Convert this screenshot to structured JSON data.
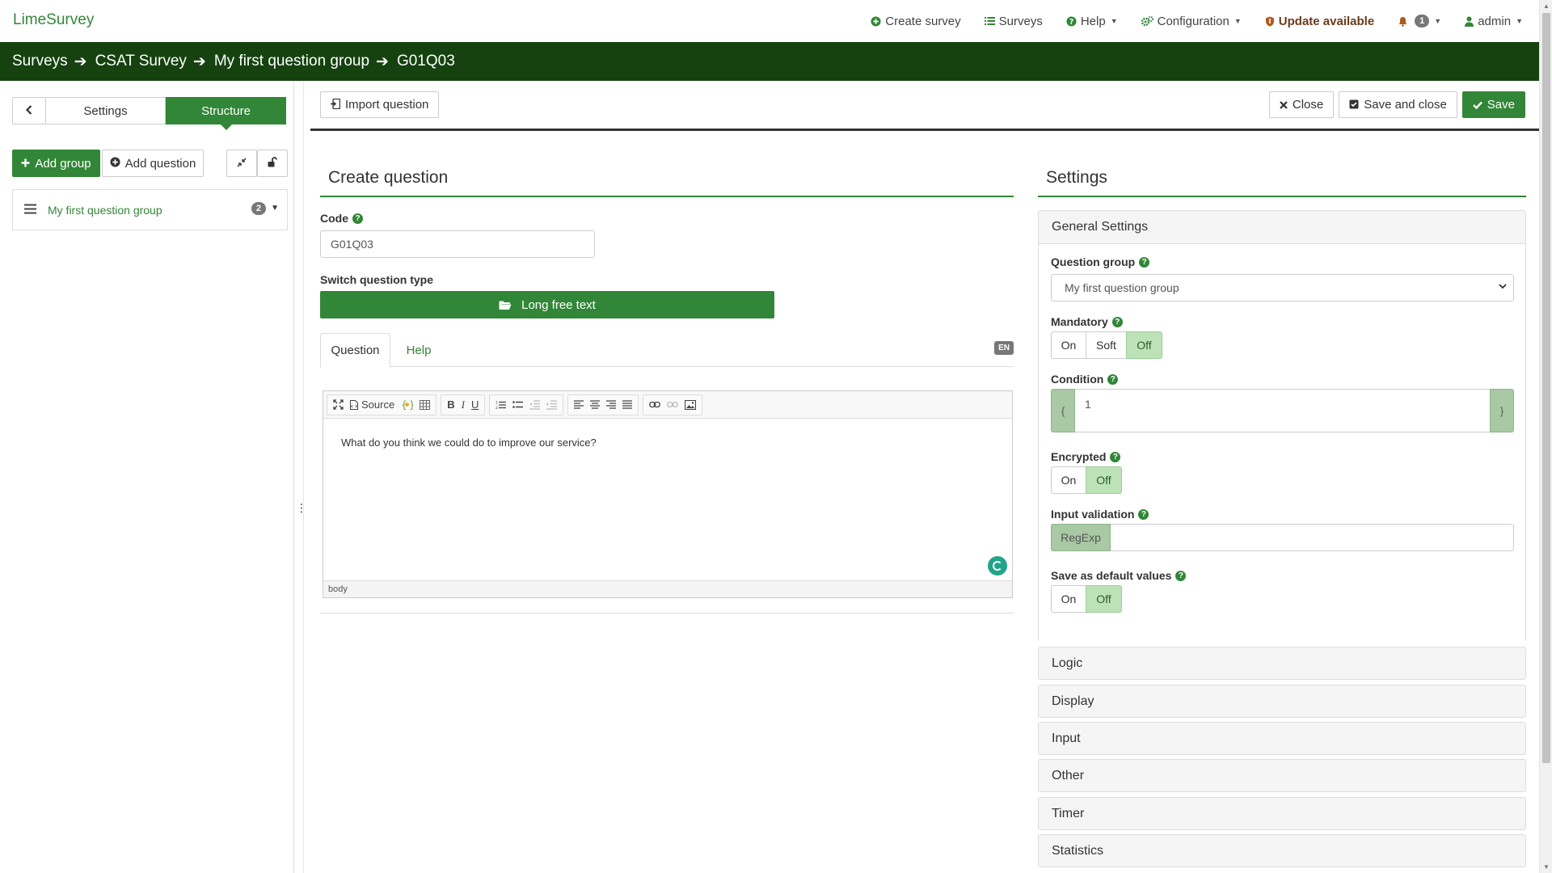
{
  "app": {
    "brand": "LimeSurvey"
  },
  "topnav": {
    "create_survey": "Create survey",
    "surveys": "Surveys",
    "help": "Help",
    "configuration": "Configuration",
    "update": "Update available",
    "notifications_count": "1",
    "user": "admin"
  },
  "breadcrumb": [
    "Surveys",
    "CSAT Survey",
    "My first question group",
    "G01Q03"
  ],
  "sidebar": {
    "tabs": {
      "settings": "Settings",
      "structure": "Structure"
    },
    "add_group": "Add group",
    "add_question": "Add question",
    "groups": [
      {
        "label": "My first question group",
        "count": "2"
      }
    ]
  },
  "toolbar": {
    "import_question": "Import question",
    "close": "Close",
    "save_and_close": "Save and close",
    "save": "Save"
  },
  "create_question": {
    "title": "Create question",
    "code_label": "Code",
    "code_value": "G01Q03",
    "switch_type_label": "Switch question type",
    "question_type": "Long free text",
    "tabs": {
      "question": "Question",
      "help": "Help"
    },
    "language_badge": "EN",
    "editor": {
      "source_label": "Source",
      "content": "What do you think we could do to improve our service?",
      "status_path": "body"
    }
  },
  "settings": {
    "title": "Settings",
    "general_settings": "General Settings",
    "question_group_label": "Question group",
    "question_group_value": "My first question group",
    "mandatory_label": "Mandatory",
    "mandatory_options": [
      "On",
      "Soft",
      "Off"
    ],
    "mandatory_selected": "Off",
    "condition_label": "Condition",
    "condition_value": "1",
    "condition_open": "{",
    "condition_close": "}",
    "encrypted_label": "Encrypted",
    "encrypted_options": [
      "On",
      "Off"
    ],
    "encrypted_selected": "Off",
    "input_validation_label": "Input validation",
    "regexp_addon": "RegExp",
    "save_default_label": "Save as default values",
    "save_default_options": [
      "On",
      "Off"
    ],
    "save_default_selected": "Off",
    "sections": [
      "Logic",
      "Display",
      "Input",
      "Other",
      "Timer",
      "Statistics"
    ]
  },
  "colors": {
    "primary_green": "#328637",
    "breadcrumb_bg": "#15420f"
  }
}
